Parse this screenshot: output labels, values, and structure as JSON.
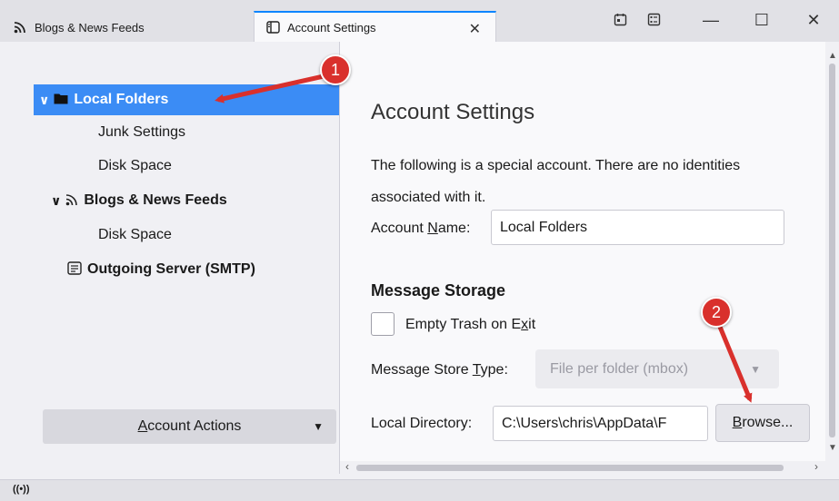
{
  "tabs": [
    {
      "label": "Blogs & News Feeds",
      "icon": "rss-icon"
    },
    {
      "label": "Account Settings",
      "icon": "settings-page-icon",
      "active": true
    }
  ],
  "window_controls": {
    "minimize": "—",
    "maximize": "☐",
    "close": "✕"
  },
  "tree": {
    "local_folders": "Local Folders",
    "junk_settings": "Junk Settings",
    "disk_space_1": "Disk Space",
    "blogs_feeds": "Blogs & News Feeds",
    "disk_space_2": "Disk Space",
    "outgoing": "Outgoing Server (SMTP)"
  },
  "account_actions": {
    "pre": "",
    "key": "A",
    "rest": "ccount Actions"
  },
  "content": {
    "title": "Account Settings",
    "description": "The following is a special account. There are no identities associated with it.",
    "name_label": {
      "pre": "Account ",
      "key": "N",
      "rest": "ame:"
    },
    "name_value": "Local Folders",
    "storage_heading": "Message Storage",
    "trash_label": {
      "pre": "Empty Trash on E",
      "key": "x",
      "rest": "it"
    },
    "trash_checked": false,
    "store_type_label": {
      "pre": "Message Store ",
      "key": "T",
      "rest": "ype:"
    },
    "store_type_value": "File per folder (mbox)",
    "dir_label": "Local Directory:",
    "dir_value": "C:\\Users\\chris\\AppData\\F",
    "browse": {
      "pre": "",
      "key": "B",
      "rest": "rowse..."
    }
  },
  "annotations": {
    "badge1": "1",
    "badge2": "2",
    "color": "#d9302c"
  },
  "colors": {
    "selection": "#3b8cf5",
    "accent": "#0a84ff"
  }
}
